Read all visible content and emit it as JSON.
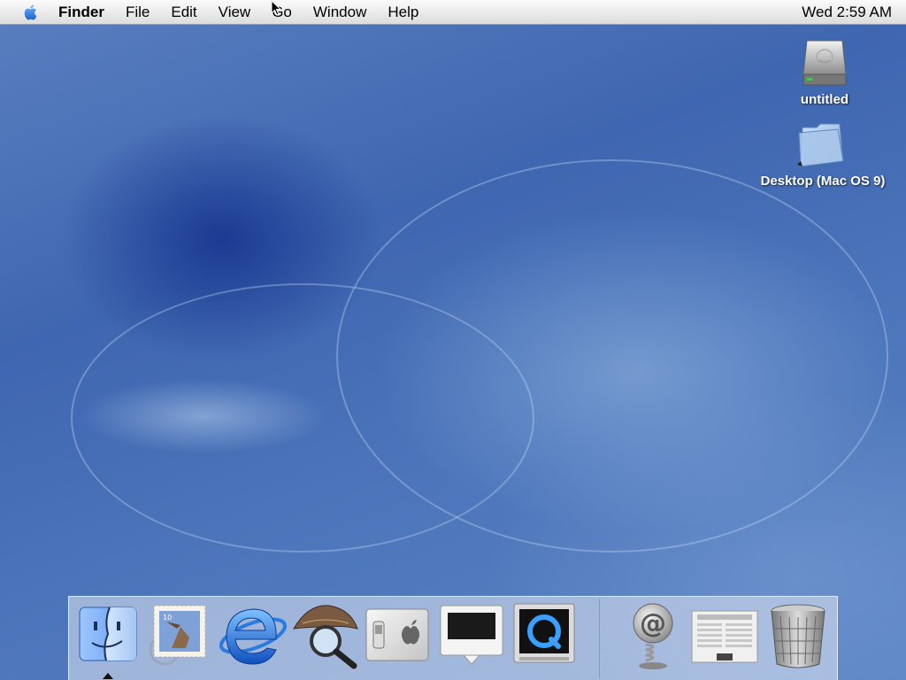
{
  "menubar": {
    "app_name": "Finder",
    "menus": [
      "File",
      "Edit",
      "View",
      "Go",
      "Window",
      "Help"
    ],
    "clock": "Wed 2:59 AM"
  },
  "desktop_icons": [
    {
      "label": "untitled",
      "icon": "hard-drive-icon"
    },
    {
      "label": "Desktop (Mac OS 9)",
      "icon": "folder-icon"
    }
  ],
  "dock": {
    "apps": [
      {
        "icon": "finder-icon",
        "running": true
      },
      {
        "icon": "mail-icon"
      },
      {
        "icon": "internet-explorer-icon"
      },
      {
        "icon": "sherlock-icon"
      },
      {
        "icon": "system-preferences-icon"
      },
      {
        "icon": "dock-display-icon"
      },
      {
        "icon": "quicktime-icon"
      }
    ],
    "documents": [
      {
        "icon": "mac-osx-email-icon"
      },
      {
        "icon": "news-document-icon"
      },
      {
        "icon": "trash-icon"
      }
    ]
  },
  "colors": {
    "wallpaper": "#3f66b0",
    "menubar": "#e9e9e9",
    "apple_logo": "#2f7be0"
  }
}
